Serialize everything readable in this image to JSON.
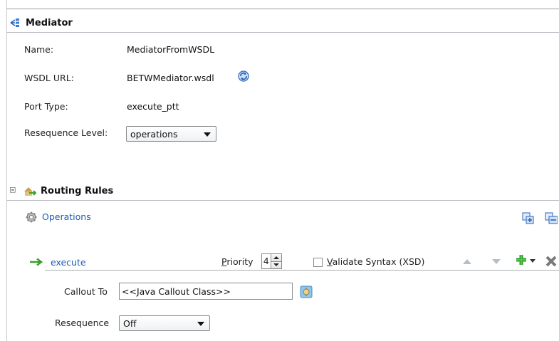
{
  "mediator": {
    "title": "Mediator",
    "name_label": "Name:",
    "name_value": "MediatorFromWSDL",
    "wsdl_label": "WSDL URL:",
    "wsdl_value": "BETWMediator.wsdl",
    "port_label": "Port Type:",
    "port_value": "execute_ptt",
    "reseq_label": "Resequence Level:",
    "reseq_value": "operations"
  },
  "routing": {
    "title": "Routing Rules",
    "operations_label": "Operations",
    "operation_name": "execute",
    "priority_label": "Priority",
    "priority_mnemonic": "P",
    "priority_rest": "riority",
    "priority_value": "4",
    "validate_label": "Validate Syntax (XSD)",
    "validate_mnemonic": "V",
    "validate_rest": "alidate Syntax (XSD)",
    "callout_label": "Callout To",
    "callout_value": "<<Java Callout Class>>",
    "reseq_label": "Resequence",
    "reseq_value": "Off"
  },
  "colors": {
    "link": "#1e5bb8",
    "add_green": "#2e9e2e",
    "arrow_green": "#3aa02b"
  }
}
